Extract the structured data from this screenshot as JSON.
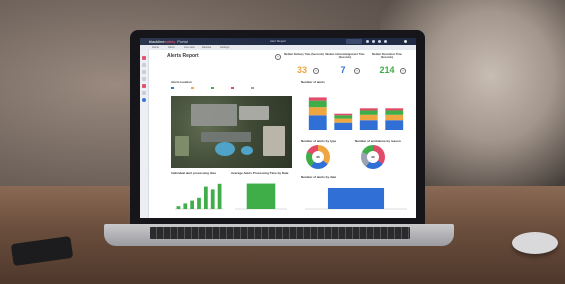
{
  "scene": {
    "description_colors": {
      "background": "#5e534c",
      "table": "#6a4d3c",
      "laptop_bezel": "#16161a"
    }
  },
  "app": {
    "brand_part1": "blackline",
    "brand_part2": "safety",
    "brand_part3": "Portal",
    "top_center": "Alert Report",
    "tabs": [
      "Home",
      "Alerts",
      "Live view",
      "Devices",
      "Settings"
    ],
    "page_title": "Alerts Report"
  },
  "kpis": [
    {
      "label": "Median Delivery Time (Seconds)",
      "value": "33",
      "color": "#f0a640"
    },
    {
      "label": "Median Acknowledgement Time (Seconds)",
      "value": "7",
      "color": "#2f6fd6"
    },
    {
      "label": "Median Resolution Time (Seconds)",
      "value": "214",
      "color": "#3fae49"
    }
  ],
  "sections": {
    "alerts_location": "Alerts location",
    "number_of_alerts": "Number of alerts",
    "individual_processing": "Individual alert processing time",
    "avg_processing": "Average Alerts Processing Time by Date",
    "alerts_by_type": "Number of alerts by type",
    "workalone_by_reason": "Number of workalone by reason",
    "alerts_by_date": "Number of alerts by date"
  },
  "donuts": [
    {
      "center": "96",
      "colors": [
        "#f0a640",
        "#2f6fd6",
        "#3fae49",
        "#e04b6a"
      ]
    },
    {
      "center": "96",
      "colors": [
        "#e04b6a",
        "#2f6fd6",
        "#9aa3b2",
        "#3fae49"
      ]
    }
  ],
  "chart_data": [
    {
      "type": "bar",
      "title": "Number of alerts",
      "series_colors": [
        "#2f6fd6",
        "#f0a640",
        "#3fae49",
        "#e04b6a"
      ],
      "categories": [
        "1",
        "2",
        "3",
        "4"
      ],
      "values": [
        6,
        3,
        4,
        4
      ]
    },
    {
      "type": "bar",
      "title": "Individual alert processing time",
      "values": [
        1,
        2,
        3,
        4,
        8,
        7,
        9
      ]
    },
    {
      "type": "bar",
      "title": "Average Alerts Processing Time by Date",
      "values": [
        10
      ]
    },
    {
      "type": "bar",
      "title": "Number of alerts by date",
      "values": [
        7
      ]
    }
  ]
}
